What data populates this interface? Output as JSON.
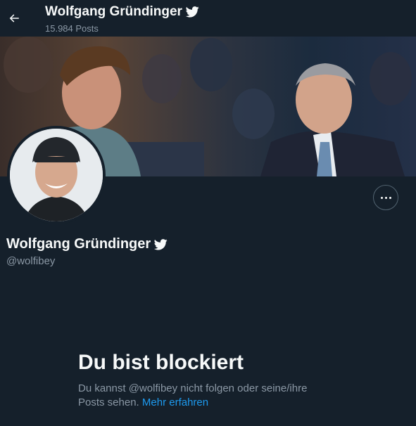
{
  "header": {
    "name": "Wolfgang Gründinger",
    "posts_count": "15.984 Posts"
  },
  "profile": {
    "name": "Wolfgang Gründinger",
    "handle": "@wolfibey"
  },
  "blocked": {
    "title": "Du bist blockiert",
    "text": "Du kannst @wolfibey nicht folgen oder seine/ihre Posts sehen.",
    "link": "Mehr erfahren"
  },
  "colors": {
    "background": "#15202b",
    "primary_text": "#f7f9f9",
    "secondary_text": "#8b98a5",
    "link": "#1d9bf0"
  },
  "icons": {
    "back": "arrow-left-icon",
    "verified": "twitter-bird-icon",
    "more": "more-horizontal-icon"
  }
}
